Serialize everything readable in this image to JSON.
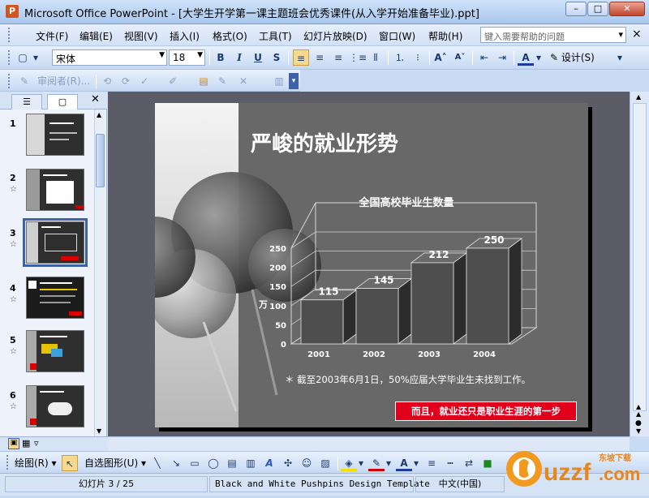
{
  "window": {
    "title": "Microsoft Office PowerPoint - [大学生开学第一课主题班会优秀课件(从入学开始准备毕业).ppt]",
    "app_icon": "P"
  },
  "menu": {
    "items": [
      "文件(F)",
      "编辑(E)",
      "视图(V)",
      "插入(I)",
      "格式(O)",
      "工具(T)",
      "幻灯片放映(D)",
      "窗口(W)",
      "帮助(H)"
    ],
    "help_placeholder": "键入需要帮助的问题"
  },
  "format_toolbar": {
    "font": "宋体",
    "size": "18",
    "bold": "B",
    "italic": "I",
    "underline": "U",
    "shadow": "S",
    "design": "设计(S)"
  },
  "review_toolbar": {
    "reviewer": "审阅者(R)..."
  },
  "thumbnails": [
    {
      "num": "1",
      "star": ""
    },
    {
      "num": "2",
      "star": "☆"
    },
    {
      "num": "3",
      "star": "☆"
    },
    {
      "num": "4",
      "star": "☆"
    },
    {
      "num": "5",
      "star": "☆"
    },
    {
      "num": "6",
      "star": "☆"
    }
  ],
  "slide": {
    "title": "严峻的就业形势",
    "note": "＊ 截至2003年6月1日，50%应届大学毕业生未找到工作。",
    "banner": "而且，就业还只是职业生涯的第一步"
  },
  "chart_data": {
    "type": "bar",
    "title": "全国高校毕业生数量",
    "ylabel": "万",
    "categories": [
      "2001",
      "2002",
      "2003",
      "2004"
    ],
    "values": [
      115,
      145,
      212,
      250
    ],
    "ylim": [
      0,
      250
    ],
    "yticks": [
      0,
      50,
      100,
      150,
      200,
      250
    ],
    "grid": true
  },
  "drawing_toolbar": {
    "draw": "绘图(R)",
    "autoshapes": "自选图形(U)"
  },
  "status": {
    "slide_pos": "幻灯片 3 / 25",
    "template": "Black and White Pushpins Design Template",
    "language": "中文(中国)"
  },
  "watermark": {
    "text": "uzzf.com",
    "sub": "东坡下载"
  },
  "colors": {
    "banner": "#e0001b",
    "slide_bg": "#6a6a6a",
    "selection": "#3e62a8"
  }
}
